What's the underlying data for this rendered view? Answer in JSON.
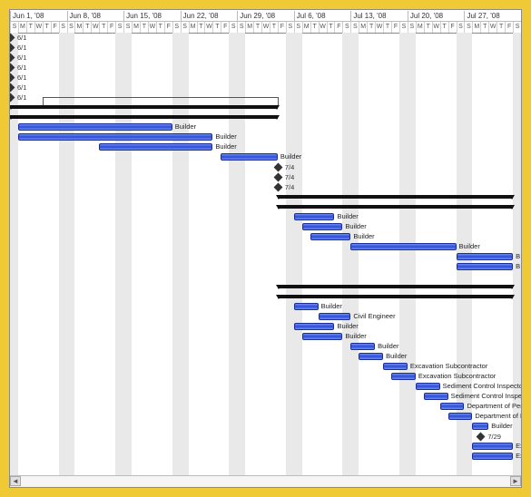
{
  "chart_data": {
    "type": "gantt",
    "timescale": {
      "unit": "day",
      "start": "2008-06-01",
      "end": "2008-08-02",
      "weeks": [
        {
          "label": "Jun 1, '08",
          "days": [
            "S",
            "M",
            "T",
            "W",
            "T",
            "F",
            "S"
          ]
        },
        {
          "label": "Jun 8, '08",
          "days": [
            "S",
            "M",
            "T",
            "W",
            "T",
            "F",
            "S"
          ]
        },
        {
          "label": "Jun 15, '08",
          "days": [
            "S",
            "M",
            "T",
            "W",
            "T",
            "F",
            "S"
          ]
        },
        {
          "label": "Jun 22, '08",
          "days": [
            "S",
            "M",
            "T",
            "W",
            "T",
            "F",
            "S"
          ]
        },
        {
          "label": "Jun 29, '08",
          "days": [
            "S",
            "M",
            "T",
            "W",
            "T",
            "F",
            "S"
          ]
        },
        {
          "label": "Jul 6, '08",
          "days": [
            "S",
            "M",
            "T",
            "W",
            "T",
            "F",
            "S"
          ]
        },
        {
          "label": "Jul 13, '08",
          "days": [
            "S",
            "M",
            "T",
            "W",
            "T",
            "F",
            "S"
          ]
        },
        {
          "label": "Jul 20, '08",
          "days": [
            "S",
            "M",
            "T",
            "W",
            "T",
            "F",
            "S"
          ]
        },
        {
          "label": "Jul 27, '08",
          "days": [
            "S",
            "M",
            "T",
            "W",
            "T",
            "F",
            "S"
          ]
        }
      ]
    },
    "rows": [
      {
        "type": "milestone",
        "day": 0,
        "label": "6/1"
      },
      {
        "type": "milestone",
        "day": 0,
        "label": "6/1"
      },
      {
        "type": "milestone",
        "day": 0,
        "label": "6/1"
      },
      {
        "type": "milestone",
        "day": 0,
        "label": "6/1"
      },
      {
        "type": "milestone",
        "day": 0,
        "label": "6/1"
      },
      {
        "type": "milestone",
        "day": 0,
        "label": "6/1"
      },
      {
        "type": "milestone",
        "day": 0,
        "label": "6/1"
      },
      {
        "type": "summary",
        "start": 0,
        "end": 33
      },
      {
        "type": "summary",
        "start": 0,
        "end": 33
      },
      {
        "type": "bar",
        "start": 1,
        "end": 20,
        "label": "Builder"
      },
      {
        "type": "bar",
        "start": 1,
        "end": 25,
        "label": "Builder"
      },
      {
        "type": "bar",
        "start": 11,
        "end": 25,
        "label": "Builder"
      },
      {
        "type": "bar",
        "start": 26,
        "end": 33,
        "label": "Builder"
      },
      {
        "type": "milestone",
        "day": 33,
        "label": "7/4"
      },
      {
        "type": "milestone",
        "day": 33,
        "label": "7/4"
      },
      {
        "type": "milestone",
        "day": 33,
        "label": "7/4"
      },
      {
        "type": "summary",
        "start": 33,
        "end": 62
      },
      {
        "type": "summary",
        "start": 33,
        "end": 62
      },
      {
        "type": "bar",
        "start": 35,
        "end": 40,
        "label": "Builder"
      },
      {
        "type": "bar",
        "start": 36,
        "end": 41,
        "label": "Builder"
      },
      {
        "type": "bar",
        "start": 37,
        "end": 42,
        "label": "Builder"
      },
      {
        "type": "bar",
        "start": 42,
        "end": 55,
        "label": "Builder"
      },
      {
        "type": "bar",
        "start": 55,
        "end": 62,
        "label": "B"
      },
      {
        "type": "bar",
        "start": 55,
        "end": 62,
        "label": "B"
      },
      {
        "type": "empty"
      },
      {
        "type": "summary",
        "start": 33,
        "end": 62
      },
      {
        "type": "summary",
        "start": 33,
        "end": 62
      },
      {
        "type": "bar",
        "start": 35,
        "end": 38,
        "label": "Builder"
      },
      {
        "type": "bar",
        "start": 38,
        "end": 42,
        "label": "Civil Engineer"
      },
      {
        "type": "bar",
        "start": 35,
        "end": 40,
        "label": "Builder"
      },
      {
        "type": "bar",
        "start": 36,
        "end": 41,
        "label": "Builder"
      },
      {
        "type": "bar",
        "start": 42,
        "end": 45,
        "label": "Builder"
      },
      {
        "type": "bar",
        "start": 43,
        "end": 46,
        "label": "Builder"
      },
      {
        "type": "bar",
        "start": 46,
        "end": 49,
        "label": "Excavation Subcontractor"
      },
      {
        "type": "bar",
        "start": 47,
        "end": 50,
        "label": "Excavation Subcontractor"
      },
      {
        "type": "bar",
        "start": 50,
        "end": 53,
        "label": "Sediment Control Inspector"
      },
      {
        "type": "bar",
        "start": 51,
        "end": 54,
        "label": "Sediment Control Inspector"
      },
      {
        "type": "bar",
        "start": 53,
        "end": 56,
        "label": "Department of Permits &"
      },
      {
        "type": "bar",
        "start": 54,
        "end": 57,
        "label": "Department of Permits &"
      },
      {
        "type": "bar",
        "start": 57,
        "end": 59,
        "label": "Builder"
      },
      {
        "type": "milestone",
        "day": 58,
        "label": "7/29"
      },
      {
        "type": "bar",
        "start": 57,
        "end": 62,
        "label": "Excavation Subcont"
      },
      {
        "type": "bar",
        "start": 57,
        "end": 62,
        "label": "Excavation"
      }
    ]
  },
  "colors": {
    "bar": "#3a55d8",
    "summary": "#111",
    "weekend": "#e9e9e9",
    "frame": "#f0ca36"
  }
}
